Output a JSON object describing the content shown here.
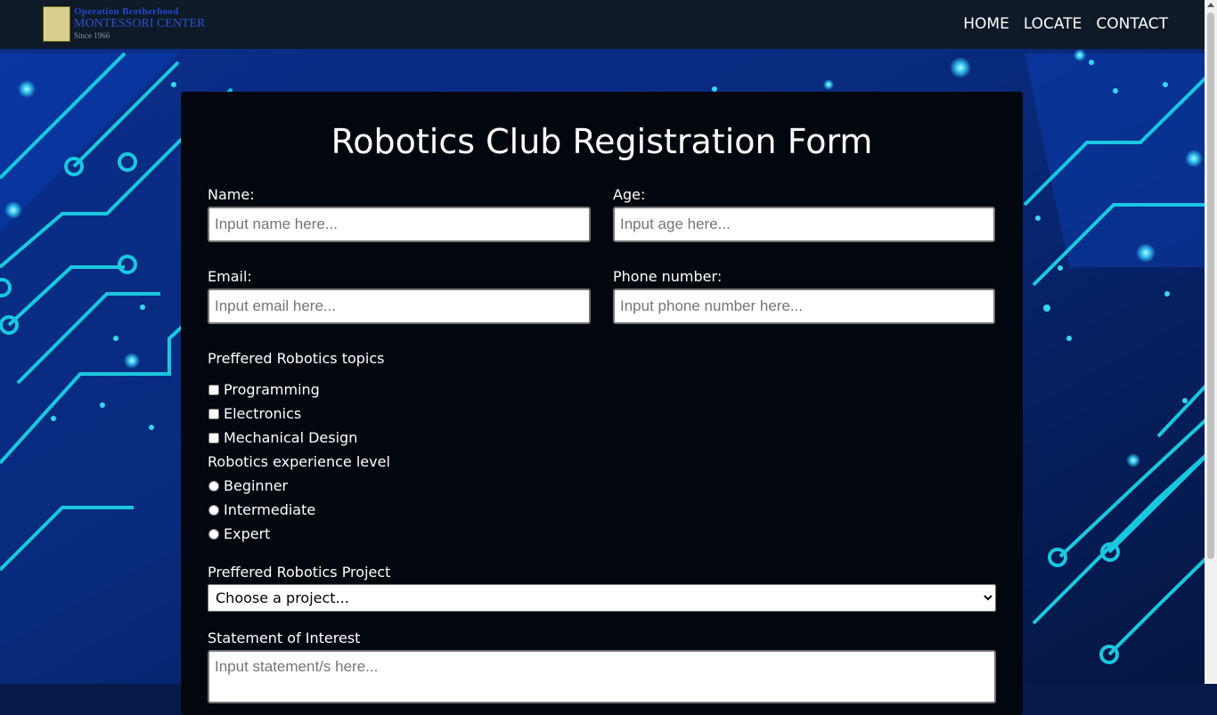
{
  "header": {
    "logo": {
      "line1": "Operation Brotherhood",
      "line2": "MONTESSORI CENTER",
      "line3": "Since 1966"
    },
    "nav": [
      "HOME",
      "LOCATE",
      "CONTACT"
    ]
  },
  "form": {
    "title": "Robotics Club Registration Form",
    "name": {
      "label": "Name:",
      "placeholder": "Input name here..."
    },
    "age": {
      "label": "Age:",
      "placeholder": "Input age here..."
    },
    "email": {
      "label": "Email:",
      "placeholder": "Input email here..."
    },
    "phone": {
      "label": "Phone number:",
      "placeholder": "Input phone number here..."
    },
    "topics": {
      "label": "Preffered Robotics topics",
      "options": [
        "Programming",
        "Electronics",
        "Mechanical Design"
      ],
      "checked": [
        false,
        false,
        false
      ]
    },
    "experience": {
      "label": "Robotics experience level",
      "options": [
        "Beginner",
        "Intermediate",
        "Expert"
      ],
      "selected": null
    },
    "project": {
      "label": "Preffered Robotics Project",
      "selected": "Choose a project..."
    },
    "statement": {
      "label": "Statement of Interest",
      "placeholder": "Input statement/s here..."
    }
  },
  "colors": {
    "navbar_bg": "#0e1a28",
    "card_bg": "#02070f",
    "background": "#061a4a",
    "circuit_accent": "#19c8e0",
    "text": "#ffffff"
  }
}
